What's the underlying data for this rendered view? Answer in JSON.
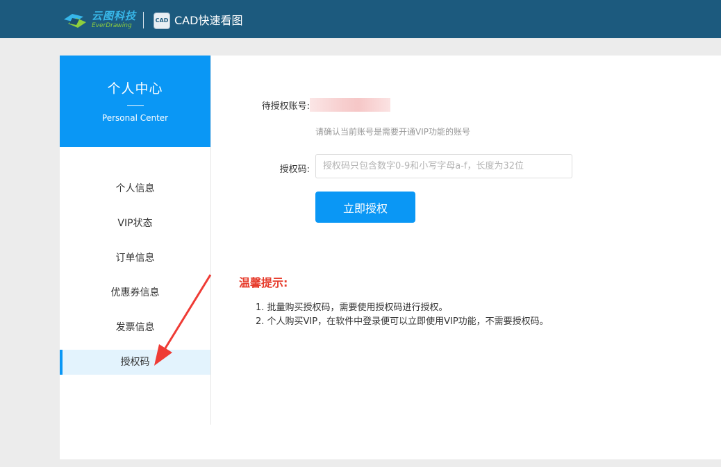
{
  "header": {
    "brand_cn": "云图科技",
    "brand_en": "EverDrawing",
    "app_icon_text": "CAD",
    "app_title": "CAD快速看图"
  },
  "sidebar": {
    "title": "个人中心",
    "subtitle": "Personal Center",
    "items": [
      {
        "label": "个人信息"
      },
      {
        "label": "VIP状态"
      },
      {
        "label": "订单信息"
      },
      {
        "label": "优惠券信息"
      },
      {
        "label": "发票信息"
      },
      {
        "label": "授权码"
      }
    ],
    "active_index": 5
  },
  "form": {
    "account_label": "待授权账号:",
    "account_hint": "请确认当前账号是需要开通VIP功能的账号",
    "code_label": "授权码:",
    "code_value": "",
    "code_placeholder": "授权码只包含数字0-9和小写字母a-f，长度为32位",
    "submit_label": "立即授权"
  },
  "tips": {
    "title": "温馨提示:",
    "items": [
      "1. 批量购买授权码，需要使用授权码进行授权。",
      "2. 个人购买VIP，在软件中登录便可以立即使用VIP功能，不需要授权码。"
    ]
  },
  "colors": {
    "header_bg": "#1c5a7e",
    "accent": "#0a97f5",
    "warning": "#e63b2b",
    "active_bg": "#e3f3fd"
  }
}
